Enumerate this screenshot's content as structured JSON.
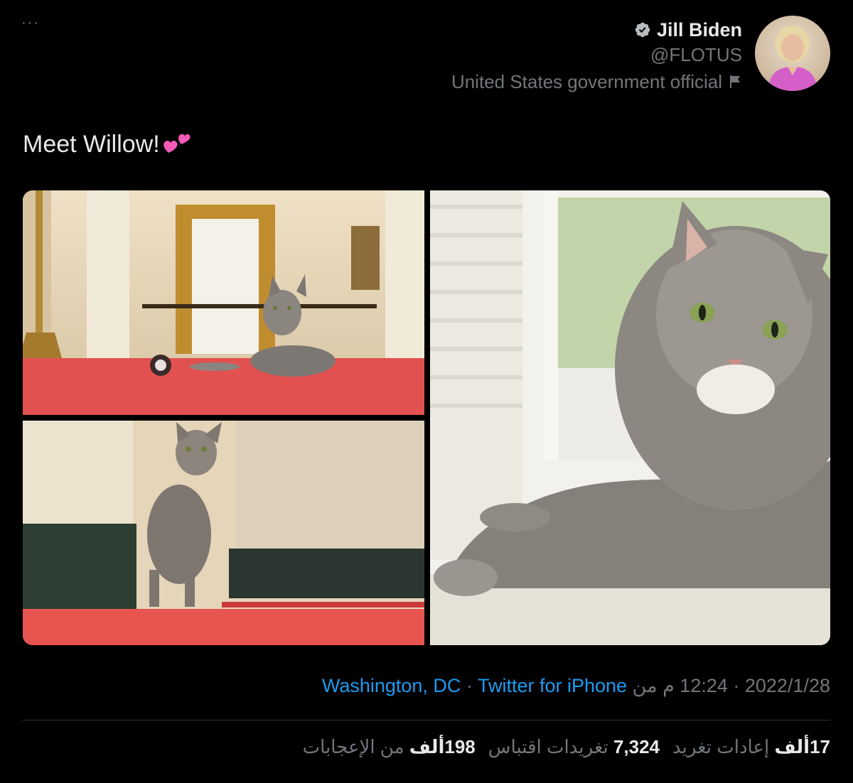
{
  "more_label": "···",
  "author": {
    "name": "Jill Biden",
    "handle": "@FLOTUS",
    "label": "United States government official"
  },
  "tweet": {
    "text": "Meet Willow!"
  },
  "meta": {
    "date": "2022/1/28",
    "separator1": " · ",
    "time": "12:24 م",
    "from": " من ",
    "location": "Washington, DC",
    "separator2": " · ",
    "source": "Twitter for iPhone"
  },
  "stats": {
    "retweets_count": "17ألف",
    "retweets_label": "إعادات تغريد",
    "quotes_count": "7,324",
    "quotes_label": "تغريدات اقتباس",
    "likes_count": "198ألف",
    "likes_label": "من الإعجابات"
  },
  "colors": {
    "background": "#000000",
    "text_primary": "#e7e9ea",
    "text_secondary": "#71767b",
    "link": "#1d9bf0",
    "divider": "#2f3336"
  },
  "icons": [
    "more-icon",
    "verified-icon",
    "flag-icon",
    "hearts-emoji"
  ]
}
